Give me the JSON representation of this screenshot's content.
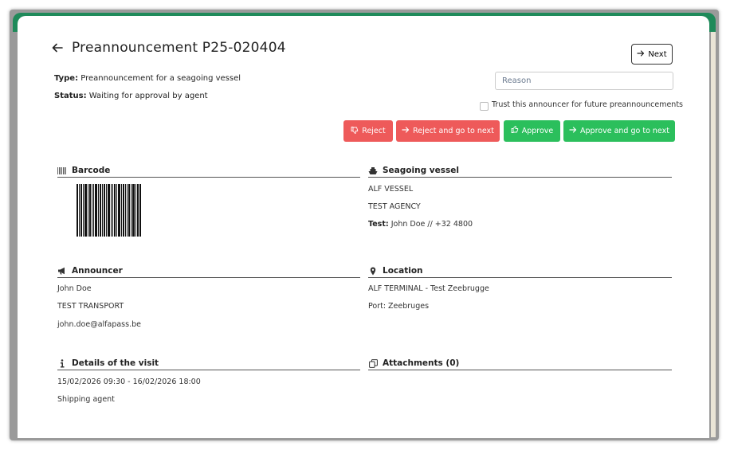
{
  "header": {
    "title": "Preannouncement P25-020404",
    "type_label": "Type:",
    "type_value": "Preannouncement for a seagoing vessel",
    "status_label": "Status:",
    "status_value": "Waiting for approval by agent",
    "next_label": "Next"
  },
  "actions": {
    "reason_placeholder": "Reason",
    "trust_label": "Trust this announcer for future preannouncements",
    "reject_label": "Reject",
    "reject_next_label": "Reject and go to next",
    "approve_label": "Approve",
    "approve_next_label": "Approve and go to next"
  },
  "barcode": {
    "heading": "Barcode"
  },
  "vessel": {
    "heading": "Seagoing vessel",
    "name": "ALF VESSEL",
    "agency": "TEST AGENCY",
    "contact_label": "Test:",
    "contact_value": "John Doe // +32 4800"
  },
  "announcer": {
    "heading": "Announcer",
    "name": "John Doe",
    "company": "TEST TRANSPORT",
    "email": "john.doe@alfapass.be"
  },
  "location": {
    "heading": "Location",
    "terminal": "ALF TERMINAL - Test Zeebrugge",
    "port": "Port: Zeebruges"
  },
  "visit": {
    "heading": "Details of the visit",
    "period": "15/02/2026 09:30 - 16/02/2026 18:00",
    "role": "Shipping agent"
  },
  "attachments": {
    "heading": "Attachments (0)"
  },
  "colors": {
    "accent_green": "#2bbf5c",
    "danger_red": "#ee5a5a",
    "frame_green": "#1f8a5a"
  },
  "icons": {
    "back": "arrow-left-icon",
    "next": "arrow-right-icon",
    "reject": "thumbs-down-icon",
    "approve": "thumbs-up-icon",
    "barcode": "barcode-icon",
    "vessel": "ship-icon",
    "announcer": "megaphone-icon",
    "location": "map-pin-icon",
    "details": "info-icon",
    "attachments": "copy-icon"
  }
}
